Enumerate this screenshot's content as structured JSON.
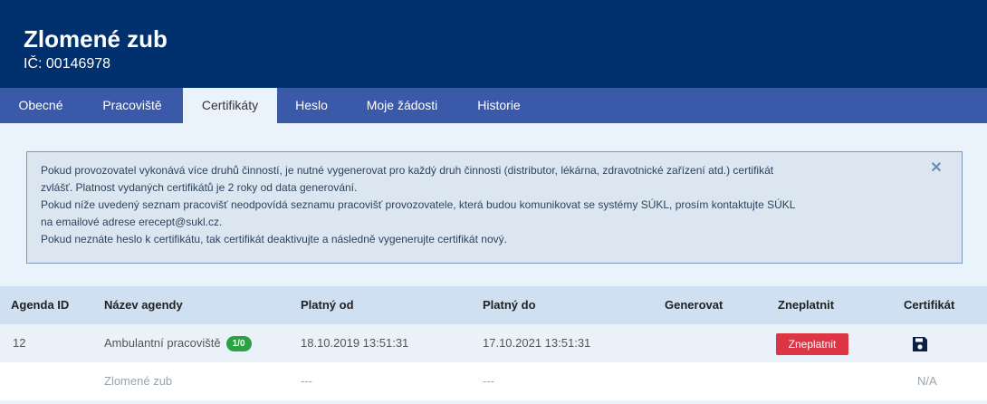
{
  "header": {
    "title": "Zlomené zub",
    "ico": "IČ: 00146978"
  },
  "nav": {
    "tabs": [
      {
        "label": "Obecné"
      },
      {
        "label": "Pracoviště"
      },
      {
        "label": "Certifikáty"
      },
      {
        "label": "Heslo"
      },
      {
        "label": "Moje žádosti"
      },
      {
        "label": "Historie"
      }
    ],
    "active_tab": "Certifikáty"
  },
  "alert": {
    "lines": [
      "Pokud provozovatel vykonává více druhů činností, je nutné vygenerovat pro každý druh činnosti (distributor, lékárna, zdravotnické zařízení atd.) certifikát",
      "zvlášť. Platnost vydaných certifikátů je 2 roky od data generování.",
      "Pokud níže uvedený seznam pracovišť neodpovídá seznamu pracovišť provozovatele, která budou komunikovat se systémy SÚKL, prosím kontaktujte SÚKL",
      "na emailové adrese erecept@sukl.cz.",
      "Pokud neznáte heslo k certifikátu, tak certifikát deaktivujte a následně vygenerujte certifikát nový."
    ],
    "close_icon": "close-icon"
  },
  "table": {
    "columns": [
      "Agenda ID",
      "Název agendy",
      "Platný od",
      "Platný do",
      "Generovat",
      "Zneplatnit",
      "Certifikát"
    ],
    "rows": [
      {
        "agenda_id": "12",
        "name": "Ambulantní pracoviště",
        "badge": "1/0",
        "valid_from": "18.10.2019 13:51:31",
        "valid_to": "17.10.2021 13:51:31",
        "revoke_label": "Zneplatnit",
        "certificate_icon": "save-icon"
      },
      {
        "agenda_id": "",
        "name": "Zlomené zub",
        "valid_from": "---",
        "valid_to": "---",
        "certificate": "N/A"
      }
    ]
  },
  "colors": {
    "header_bg": "#00306e",
    "nav_bg": "#3b59a9",
    "content_bg": "#eaf2fb",
    "badge_green": "#2aa144",
    "revoke_red": "#dc3545"
  }
}
